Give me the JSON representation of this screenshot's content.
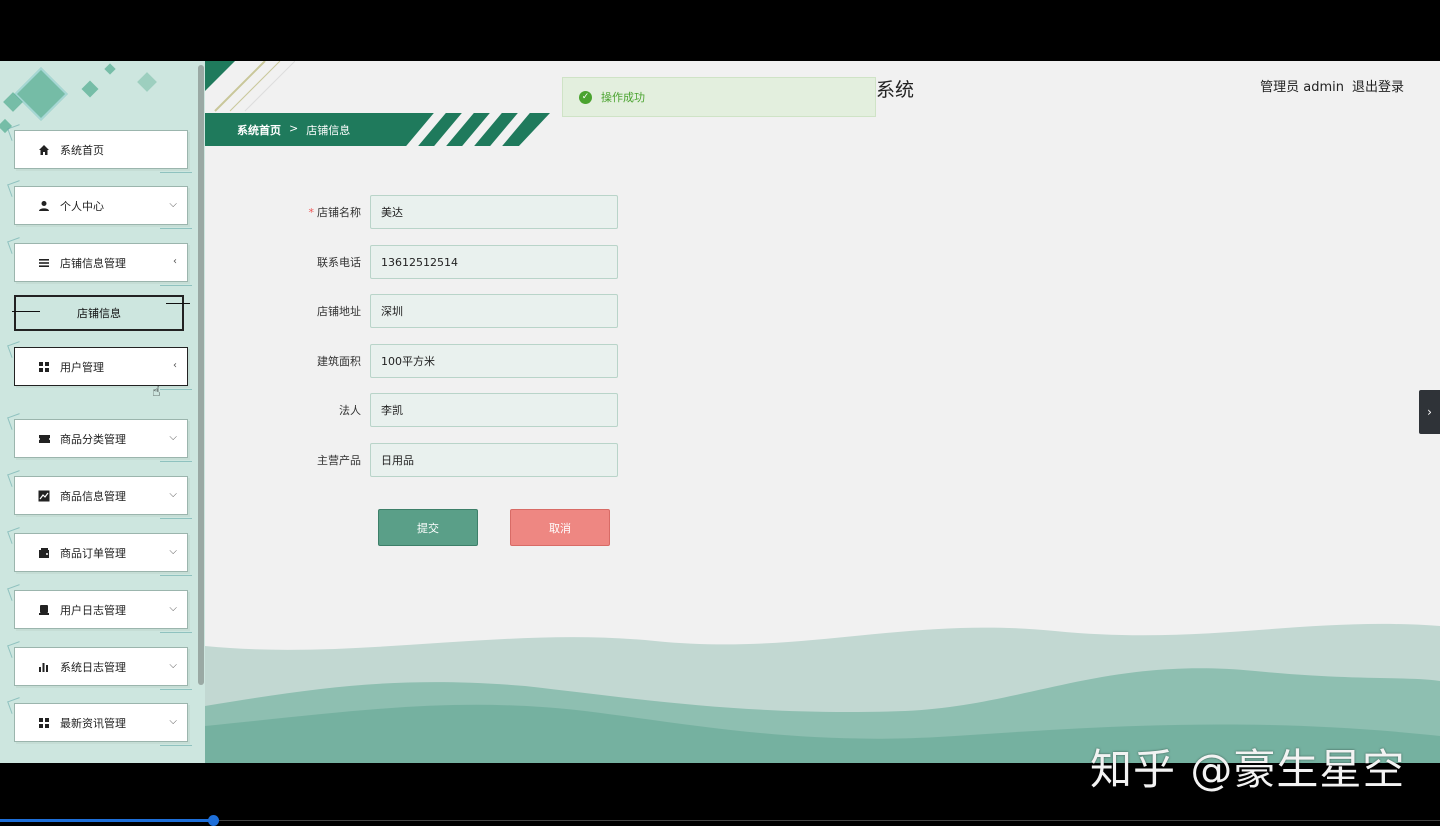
{
  "header": {
    "system_title": "系统",
    "user_label": "管理员 admin",
    "logout_label": "退出登录"
  },
  "breadcrumb": {
    "home": "系统首页",
    "separator": ">",
    "current": "店铺信息"
  },
  "toast": {
    "message": "操作成功",
    "color": "#4aa32f"
  },
  "sidebar": {
    "items": [
      {
        "label": "系统首页",
        "icon": "home-icon",
        "arrow": ""
      },
      {
        "label": "个人中心",
        "icon": "person-icon",
        "arrow": "⌵"
      },
      {
        "label": "店铺信息管理",
        "icon": "list-icon",
        "arrow": "‹"
      },
      {
        "label": "用户管理",
        "icon": "grid-icon",
        "arrow": "‹"
      },
      {
        "label": "商品分类管理",
        "icon": "ticket-icon",
        "arrow": "⌵"
      },
      {
        "label": "商品信息管理",
        "icon": "chart-line-icon",
        "arrow": "⌵"
      },
      {
        "label": "商品订单管理",
        "icon": "wallet-icon",
        "arrow": "⌵"
      },
      {
        "label": "用户日志管理",
        "icon": "printer-icon",
        "arrow": "⌵"
      },
      {
        "label": "系统日志管理",
        "icon": "bar-chart-icon",
        "arrow": "⌵"
      },
      {
        "label": "最新资讯管理",
        "icon": "grid-icon",
        "arrow": "⌵"
      }
    ],
    "sub_item": {
      "label": "店铺信息"
    }
  },
  "form": {
    "fields": [
      {
        "label": "店铺名称",
        "value": "美达",
        "required": true
      },
      {
        "label": "联系电话",
        "value": "13612512514",
        "required": false
      },
      {
        "label": "店铺地址",
        "value": "深圳",
        "required": false
      },
      {
        "label": "建筑面积",
        "value": "100平方米",
        "required": false
      },
      {
        "label": "法人",
        "value": "李凯",
        "required": false
      },
      {
        "label": "主营产品",
        "value": "日用品",
        "required": false
      }
    ],
    "required_mark": "*",
    "submit_label": "提交",
    "cancel_label": "取消"
  },
  "colors": {
    "accent": "#1f7a5c",
    "sidebar_bg": "#cde6df",
    "submit": "#5a9f88",
    "cancel": "#ee8782"
  },
  "watermark": "知乎 @豪生星空"
}
